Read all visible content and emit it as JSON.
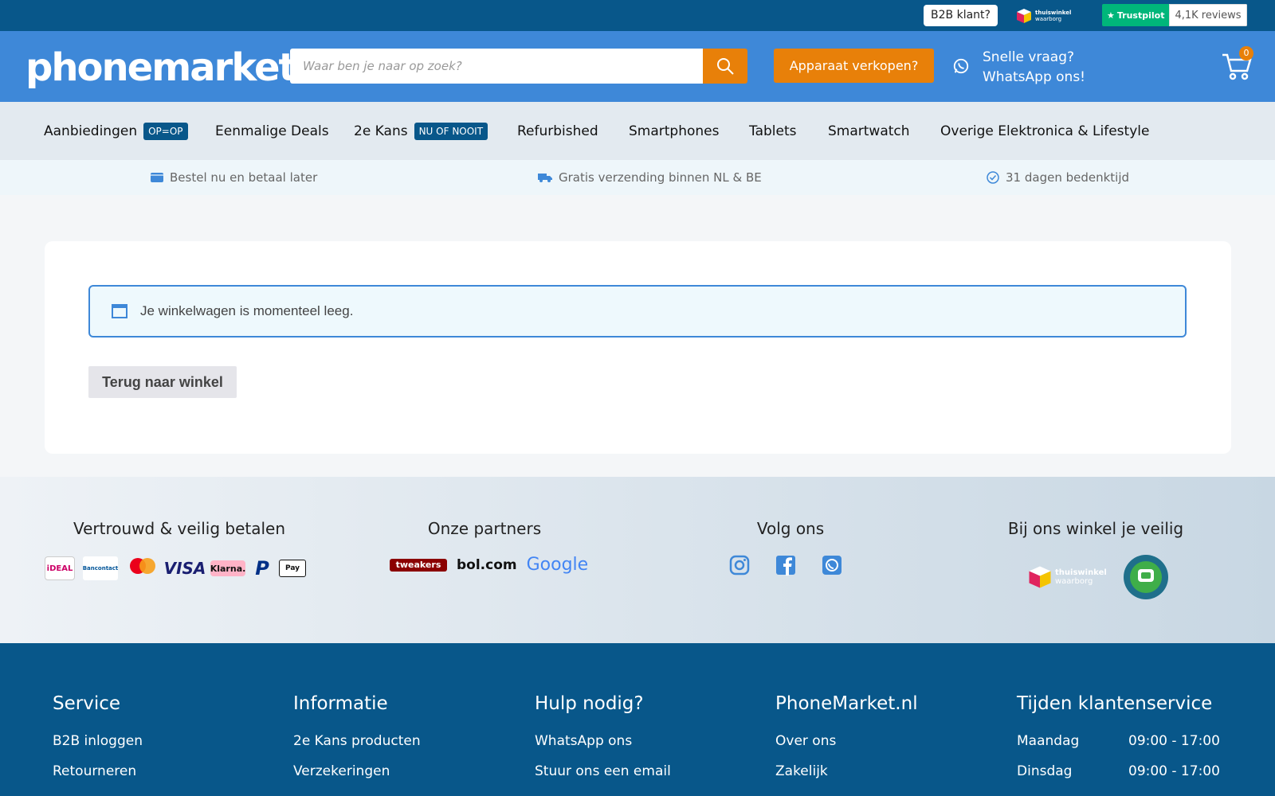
{
  "topbar": {
    "b2b_label": "B2B klant?",
    "thuiswinkel_top": "thuiswinkel",
    "thuiswinkel_bottom": "waarborg",
    "trustpilot_label": "Trustpilot",
    "reviews": "4,1K reviews"
  },
  "header": {
    "logo": "phonemarket",
    "search_placeholder": "Waar ben je naar op zoek?",
    "sell_label": "Apparaat verkopen?",
    "whatsapp_line1": "Snelle vraag?",
    "whatsapp_line2": "WhatsApp ons!",
    "cart_count": "0"
  },
  "nav": {
    "items": [
      {
        "label": "Aanbiedingen",
        "badge": "OP=OP"
      },
      {
        "label": "Eenmalige Deals"
      },
      {
        "label": "2e Kans",
        "badge": "NU OF NOOIT"
      },
      {
        "label": "Refurbished"
      },
      {
        "label": "Smartphones"
      },
      {
        "label": "Tablets"
      },
      {
        "label": "Smartwatch"
      },
      {
        "label": "Overige Elektronica & Lifestyle"
      }
    ]
  },
  "usps": [
    {
      "icon": "wallet-icon",
      "label": "Bestel nu en betaal later"
    },
    {
      "icon": "truck-icon",
      "label": "Gratis verzending binnen NL & BE"
    },
    {
      "icon": "check-circle-icon",
      "label": "31 dagen bedenktijd"
    }
  ],
  "cart": {
    "empty_message": "Je winkelwagen is momenteel leeg.",
    "back_button": "Terug naar winkel"
  },
  "trust": {
    "pay_title": "Vertrouwd & veilig betalen",
    "partners_title": "Onze partners",
    "follow_title": "Volg ons",
    "safe_title": "Bij ons winkel je veilig",
    "payment_logos": [
      "iDEAL",
      "Bancontact",
      "mastercard",
      "VISA",
      "Klarna.",
      "PayPal",
      "Apple Pay"
    ],
    "partners": [
      "tweakers",
      "bol.com",
      "Google"
    ],
    "socials": [
      "instagram-icon",
      "facebook-icon",
      "whatsapp-icon"
    ],
    "safe_logos": {
      "thuiswinkel_top": "thuiswinkel",
      "thuiswinkel_bottom": "waarborg",
      "qshops": "QSHOPS KEURMERK"
    }
  },
  "footer": {
    "columns": [
      {
        "title": "Service",
        "links": [
          "B2B inloggen",
          "Retourneren"
        ]
      },
      {
        "title": "Informatie",
        "links": [
          "2e Kans producten",
          "Verzekeringen"
        ]
      },
      {
        "title": "Hulp nodig?",
        "links": [
          "WhatsApp ons",
          "Stuur ons een email"
        ]
      },
      {
        "title": "PhoneMarket.nl",
        "links": [
          "Over ons",
          "Zakelijk"
        ]
      },
      {
        "title": "Tijden klantenservice",
        "hours": [
          {
            "day": "Maandag",
            "time": "09:00 - 17:00"
          },
          {
            "day": "Dinsdag",
            "time": "09:00 - 17:00"
          }
        ]
      }
    ]
  },
  "colors": {
    "primary": "#08578a",
    "header": "#3e88d8",
    "accent": "#e88009"
  }
}
